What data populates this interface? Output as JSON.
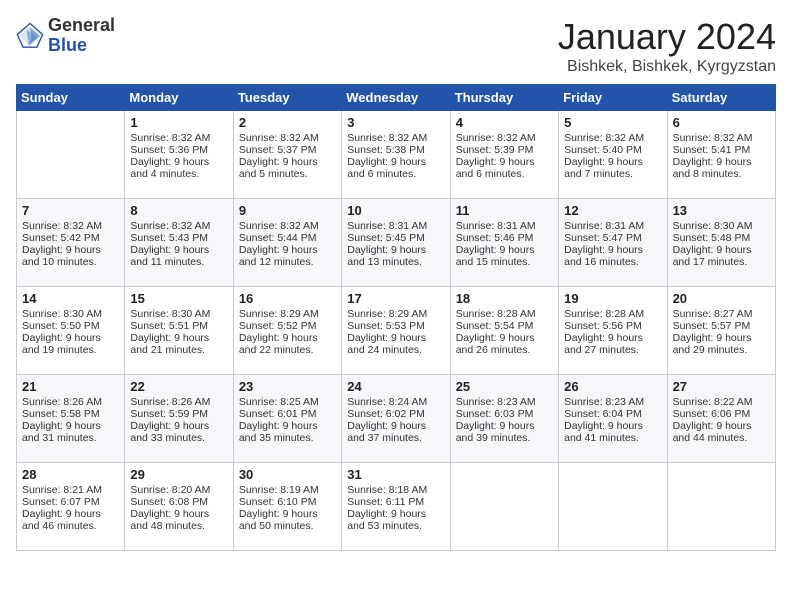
{
  "header": {
    "logo_general": "General",
    "logo_blue": "Blue",
    "month_title": "January 2024",
    "location": "Bishkek, Bishkek, Kyrgyzstan"
  },
  "days_of_week": [
    "Sunday",
    "Monday",
    "Tuesday",
    "Wednesday",
    "Thursday",
    "Friday",
    "Saturday"
  ],
  "weeks": [
    [
      {
        "num": "",
        "sunrise": "",
        "sunset": "",
        "daylight": ""
      },
      {
        "num": "1",
        "sunrise": "Sunrise: 8:32 AM",
        "sunset": "Sunset: 5:36 PM",
        "daylight": "Daylight: 9 hours and 4 minutes."
      },
      {
        "num": "2",
        "sunrise": "Sunrise: 8:32 AM",
        "sunset": "Sunset: 5:37 PM",
        "daylight": "Daylight: 9 hours and 5 minutes."
      },
      {
        "num": "3",
        "sunrise": "Sunrise: 8:32 AM",
        "sunset": "Sunset: 5:38 PM",
        "daylight": "Daylight: 9 hours and 6 minutes."
      },
      {
        "num": "4",
        "sunrise": "Sunrise: 8:32 AM",
        "sunset": "Sunset: 5:39 PM",
        "daylight": "Daylight: 9 hours and 6 minutes."
      },
      {
        "num": "5",
        "sunrise": "Sunrise: 8:32 AM",
        "sunset": "Sunset: 5:40 PM",
        "daylight": "Daylight: 9 hours and 7 minutes."
      },
      {
        "num": "6",
        "sunrise": "Sunrise: 8:32 AM",
        "sunset": "Sunset: 5:41 PM",
        "daylight": "Daylight: 9 hours and 8 minutes."
      }
    ],
    [
      {
        "num": "7",
        "sunrise": "Sunrise: 8:32 AM",
        "sunset": "Sunset: 5:42 PM",
        "daylight": "Daylight: 9 hours and 10 minutes."
      },
      {
        "num": "8",
        "sunrise": "Sunrise: 8:32 AM",
        "sunset": "Sunset: 5:43 PM",
        "daylight": "Daylight: 9 hours and 11 minutes."
      },
      {
        "num": "9",
        "sunrise": "Sunrise: 8:32 AM",
        "sunset": "Sunset: 5:44 PM",
        "daylight": "Daylight: 9 hours and 12 minutes."
      },
      {
        "num": "10",
        "sunrise": "Sunrise: 8:31 AM",
        "sunset": "Sunset: 5:45 PM",
        "daylight": "Daylight: 9 hours and 13 minutes."
      },
      {
        "num": "11",
        "sunrise": "Sunrise: 8:31 AM",
        "sunset": "Sunset: 5:46 PM",
        "daylight": "Daylight: 9 hours and 15 minutes."
      },
      {
        "num": "12",
        "sunrise": "Sunrise: 8:31 AM",
        "sunset": "Sunset: 5:47 PM",
        "daylight": "Daylight: 9 hours and 16 minutes."
      },
      {
        "num": "13",
        "sunrise": "Sunrise: 8:30 AM",
        "sunset": "Sunset: 5:48 PM",
        "daylight": "Daylight: 9 hours and 17 minutes."
      }
    ],
    [
      {
        "num": "14",
        "sunrise": "Sunrise: 8:30 AM",
        "sunset": "Sunset: 5:50 PM",
        "daylight": "Daylight: 9 hours and 19 minutes."
      },
      {
        "num": "15",
        "sunrise": "Sunrise: 8:30 AM",
        "sunset": "Sunset: 5:51 PM",
        "daylight": "Daylight: 9 hours and 21 minutes."
      },
      {
        "num": "16",
        "sunrise": "Sunrise: 8:29 AM",
        "sunset": "Sunset: 5:52 PM",
        "daylight": "Daylight: 9 hours and 22 minutes."
      },
      {
        "num": "17",
        "sunrise": "Sunrise: 8:29 AM",
        "sunset": "Sunset: 5:53 PM",
        "daylight": "Daylight: 9 hours and 24 minutes."
      },
      {
        "num": "18",
        "sunrise": "Sunrise: 8:28 AM",
        "sunset": "Sunset: 5:54 PM",
        "daylight": "Daylight: 9 hours and 26 minutes."
      },
      {
        "num": "19",
        "sunrise": "Sunrise: 8:28 AM",
        "sunset": "Sunset: 5:56 PM",
        "daylight": "Daylight: 9 hours and 27 minutes."
      },
      {
        "num": "20",
        "sunrise": "Sunrise: 8:27 AM",
        "sunset": "Sunset: 5:57 PM",
        "daylight": "Daylight: 9 hours and 29 minutes."
      }
    ],
    [
      {
        "num": "21",
        "sunrise": "Sunrise: 8:26 AM",
        "sunset": "Sunset: 5:58 PM",
        "daylight": "Daylight: 9 hours and 31 minutes."
      },
      {
        "num": "22",
        "sunrise": "Sunrise: 8:26 AM",
        "sunset": "Sunset: 5:59 PM",
        "daylight": "Daylight: 9 hours and 33 minutes."
      },
      {
        "num": "23",
        "sunrise": "Sunrise: 8:25 AM",
        "sunset": "Sunset: 6:01 PM",
        "daylight": "Daylight: 9 hours and 35 minutes."
      },
      {
        "num": "24",
        "sunrise": "Sunrise: 8:24 AM",
        "sunset": "Sunset: 6:02 PM",
        "daylight": "Daylight: 9 hours and 37 minutes."
      },
      {
        "num": "25",
        "sunrise": "Sunrise: 8:23 AM",
        "sunset": "Sunset: 6:03 PM",
        "daylight": "Daylight: 9 hours and 39 minutes."
      },
      {
        "num": "26",
        "sunrise": "Sunrise: 8:23 AM",
        "sunset": "Sunset: 6:04 PM",
        "daylight": "Daylight: 9 hours and 41 minutes."
      },
      {
        "num": "27",
        "sunrise": "Sunrise: 8:22 AM",
        "sunset": "Sunset: 6:06 PM",
        "daylight": "Daylight: 9 hours and 44 minutes."
      }
    ],
    [
      {
        "num": "28",
        "sunrise": "Sunrise: 8:21 AM",
        "sunset": "Sunset: 6:07 PM",
        "daylight": "Daylight: 9 hours and 46 minutes."
      },
      {
        "num": "29",
        "sunrise": "Sunrise: 8:20 AM",
        "sunset": "Sunset: 6:08 PM",
        "daylight": "Daylight: 9 hours and 48 minutes."
      },
      {
        "num": "30",
        "sunrise": "Sunrise: 8:19 AM",
        "sunset": "Sunset: 6:10 PM",
        "daylight": "Daylight: 9 hours and 50 minutes."
      },
      {
        "num": "31",
        "sunrise": "Sunrise: 8:18 AM",
        "sunset": "Sunset: 6:11 PM",
        "daylight": "Daylight: 9 hours and 53 minutes."
      },
      {
        "num": "",
        "sunrise": "",
        "sunset": "",
        "daylight": ""
      },
      {
        "num": "",
        "sunrise": "",
        "sunset": "",
        "daylight": ""
      },
      {
        "num": "",
        "sunrise": "",
        "sunset": "",
        "daylight": ""
      }
    ]
  ]
}
